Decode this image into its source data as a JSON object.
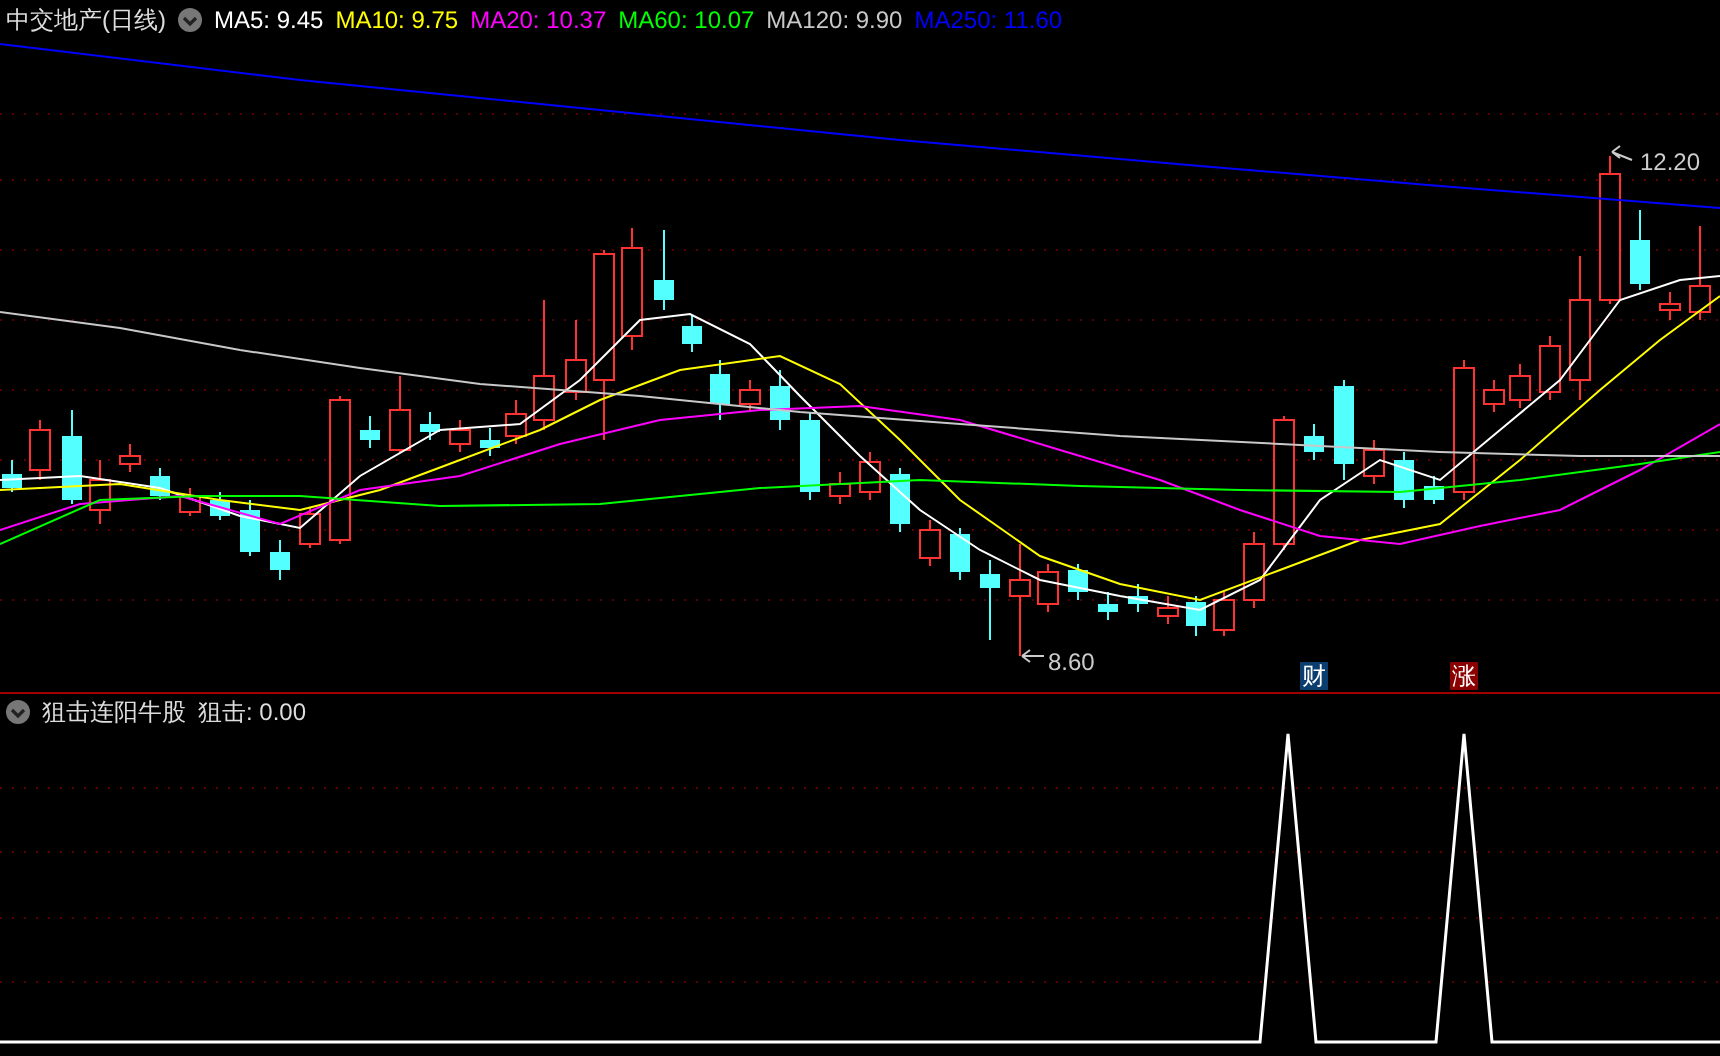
{
  "header": {
    "title": "中交地产(日线)",
    "averages": [
      {
        "label": "MA5: 9.45",
        "color": "#ffffff"
      },
      {
        "label": "MA10: 9.75",
        "color": "#ffff00"
      },
      {
        "label": "MA20: 10.37",
        "color": "#ff00ff"
      },
      {
        "label": "MA60: 10.07",
        "color": "#00ff00"
      },
      {
        "label": "MA120: 9.90",
        "color": "#c8c8c8"
      },
      {
        "label": "MA250: 11.60",
        "color": "#0000ff"
      }
    ]
  },
  "price_chart": {
    "high_label": "12.20",
    "low_label": "8.60",
    "markers": [
      {
        "text": "财",
        "color": "#0b3d6e"
      },
      {
        "text": "涨",
        "color": "#8b0000"
      }
    ]
  },
  "indicator": {
    "title": "狙击连阳牛股",
    "reading": "狙击: 0.00"
  }
}
